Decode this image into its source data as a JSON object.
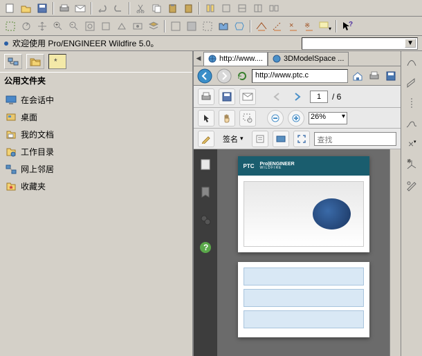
{
  "welcome_text": "欢迎使用 Pro/ENGINEER Wildfire 5.0。",
  "folders": {
    "title": "公用文件夹",
    "items": [
      {
        "label": "在会话中",
        "icon": "monitor"
      },
      {
        "label": "桌面",
        "icon": "desktop"
      },
      {
        "label": "我的文档",
        "icon": "mydocs"
      },
      {
        "label": "工作目录",
        "icon": "workdir"
      },
      {
        "label": "网上邻居",
        "icon": "network"
      },
      {
        "label": "收藏夹",
        "icon": "favorites"
      }
    ]
  },
  "tabs": [
    {
      "label": "http://www....",
      "active": true
    },
    {
      "label": "3DModelSpace ...",
      "active": false
    }
  ],
  "address_url": "http://www.ptc.c",
  "pdf": {
    "page_current": "1",
    "page_total": "6",
    "zoom": "26%",
    "sign_label": "签名",
    "find_placeholder": "查找"
  },
  "ptc": {
    "brand": "PTC",
    "product": "Pro|ENGINEER",
    "sub": "WILDFIRE"
  }
}
